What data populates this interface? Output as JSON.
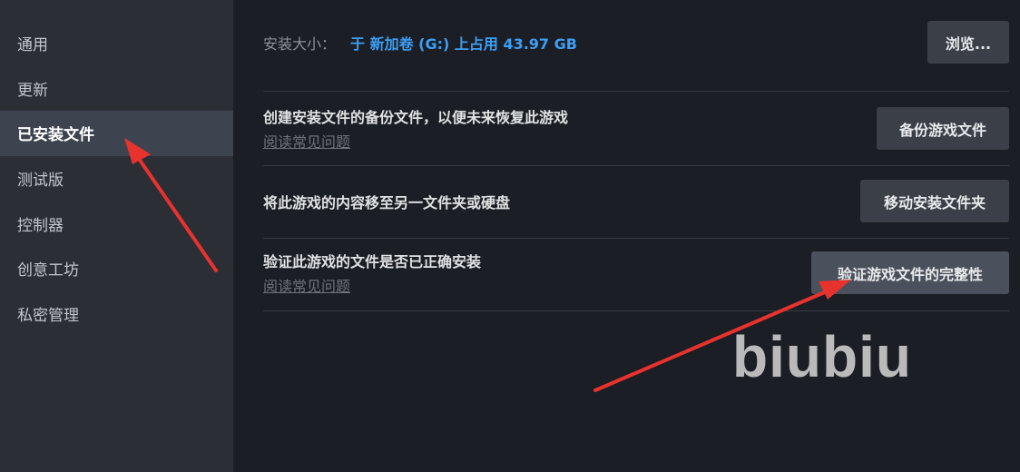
{
  "sidebar": {
    "items": [
      {
        "label": "通用"
      },
      {
        "label": "更新"
      },
      {
        "label": "已安装文件",
        "active": true
      },
      {
        "label": "测试版"
      },
      {
        "label": "控制器"
      },
      {
        "label": "创意工坊"
      },
      {
        "label": "私密管理"
      }
    ]
  },
  "install": {
    "size_label": "安装大小：",
    "size_value": "于 新加卷 (G:) 上占用 43.97 GB",
    "browse_label": "浏览..."
  },
  "backup": {
    "description": "创建安装文件的备份文件，以便未来恢复此游戏",
    "faq_link": "阅读常见问题",
    "button_label": "备份游戏文件"
  },
  "move": {
    "description": "将此游戏的内容移至另一文件夹或硬盘",
    "button_label": "移动安装文件夹"
  },
  "verify": {
    "description": "验证此游戏的文件是否已正确安装",
    "faq_link": "阅读常见问题",
    "button_label": "验证游戏文件的完整性"
  },
  "watermark": {
    "text": "biubiu"
  },
  "colors": {
    "accent_blue": "#3d9ff5",
    "annotation_red": "#e8322d",
    "sidebar_bg": "#2b2e35",
    "main_bg": "#1b1e24"
  }
}
